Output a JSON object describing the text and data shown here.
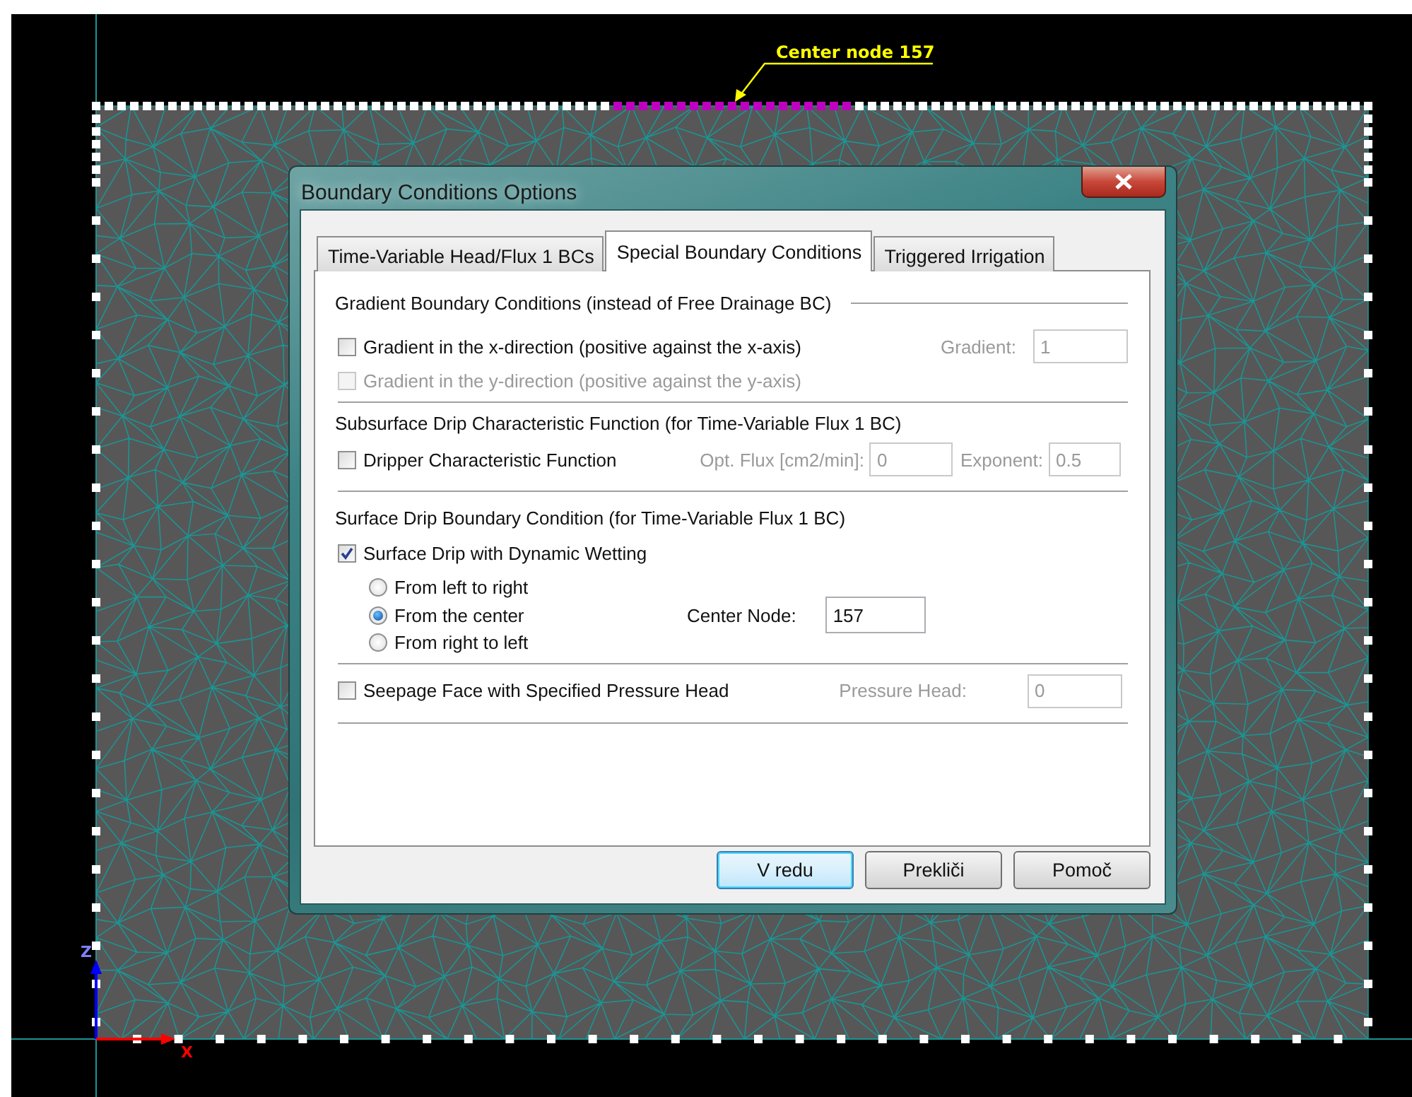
{
  "canvas": {
    "annotation": "Center node 157",
    "axis_labels": [
      "Z",
      "X"
    ]
  },
  "dialog": {
    "title": "Boundary Conditions Options",
    "tabs": [
      {
        "label": "Time-Variable Head/Flux 1 BCs",
        "selected": false
      },
      {
        "label": "Special Boundary Conditions",
        "selected": true
      },
      {
        "label": "Triggered Irrigation",
        "selected": false
      }
    ],
    "gradient": {
      "title": "Gradient Boundary Conditions (instead of Free Drainage BC)",
      "options": [
        {
          "label": "Gradient in the x-direction (positive against the x-axis)",
          "checked": false,
          "disabled": false
        },
        {
          "label": "Gradient in the y-direction (positive against the y-axis)",
          "checked": false,
          "disabled": true
        }
      ],
      "field": {
        "label": "Gradient:",
        "value": "1",
        "disabled": true
      }
    },
    "subsurface": {
      "title": "Subsurface Drip Characteristic Function (for Time-Variable Flux 1 BC)",
      "option": {
        "label": "Dripper Characteristic Function",
        "checked": false,
        "disabled": false
      },
      "fields": [
        {
          "label": "Opt. Flux [cm2/min]:",
          "value": "0",
          "disabled": true
        },
        {
          "label": "Exponent:",
          "value": "0.5",
          "disabled": true
        }
      ]
    },
    "surface": {
      "title": "Surface Drip Boundary Condition (for Time-Variable Flux 1 BC)",
      "option": {
        "label": "Surface Drip with Dynamic Wetting",
        "checked": true,
        "disabled": false
      },
      "radios": [
        {
          "label": "From left to right",
          "selected": false
        },
        {
          "label": "From the center",
          "selected": true
        },
        {
          "label": "From right to left",
          "selected": false
        }
      ],
      "field": {
        "label": "Center Node:",
        "value": "157",
        "disabled": false
      }
    },
    "seepage": {
      "option": {
        "label": "Seepage Face with Specified Pressure Head",
        "checked": false,
        "disabled": false
      },
      "field": {
        "label": "Pressure Head:",
        "value": "0",
        "disabled": true
      }
    },
    "buttons": [
      {
        "label": "V redu",
        "default": true
      },
      {
        "label": "Prekliči",
        "default": false
      },
      {
        "label": "Pomoč",
        "default": false
      }
    ]
  }
}
